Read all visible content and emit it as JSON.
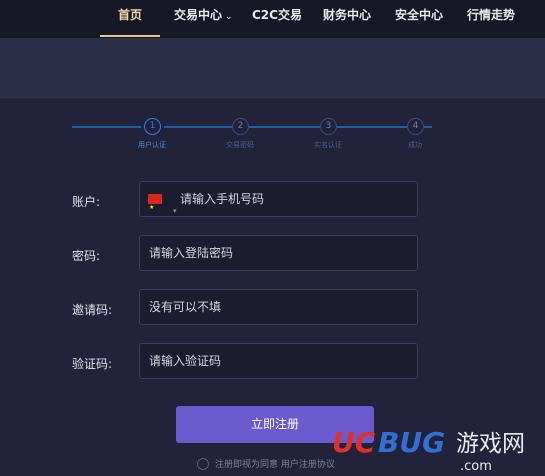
{
  "nav": {
    "items": [
      {
        "label": "首页",
        "active": true
      },
      {
        "label": "交易中心",
        "has_dropdown": true
      },
      {
        "label": "C2C交易"
      },
      {
        "label": "财务中心"
      },
      {
        "label": "安全中心"
      },
      {
        "label": "行情走势"
      }
    ]
  },
  "steps": [
    {
      "number": "1",
      "label": "用户认证",
      "active": true
    },
    {
      "number": "2",
      "label": "交易密码"
    },
    {
      "number": "3",
      "label": "实名认证"
    },
    {
      "number": "4",
      "label": "成功"
    }
  ],
  "form": {
    "account": {
      "label": "账户:",
      "placeholder": "请输入手机号码",
      "flag": "china-flag-icon"
    },
    "password": {
      "label": "密码:",
      "placeholder": "请输入登陆密码"
    },
    "invite": {
      "label": "邀请码:",
      "placeholder": "没有可以不填"
    },
    "captcha": {
      "label": "验证码:",
      "placeholder": "请输入验证码"
    },
    "submit_label": "立即注册",
    "agree_text": "注册即视为同意 用户注册协议"
  },
  "watermark": {
    "brand": "UCBUG",
    "suffix": "游戏网",
    "domain": ".com"
  },
  "colors": {
    "background": "#22233b",
    "nav_background": "#171826",
    "nav_active": "#f1d9a8",
    "accent_blue": "#2f7be0",
    "button": "#6a5acd",
    "watermark_red": "#e0302b"
  }
}
